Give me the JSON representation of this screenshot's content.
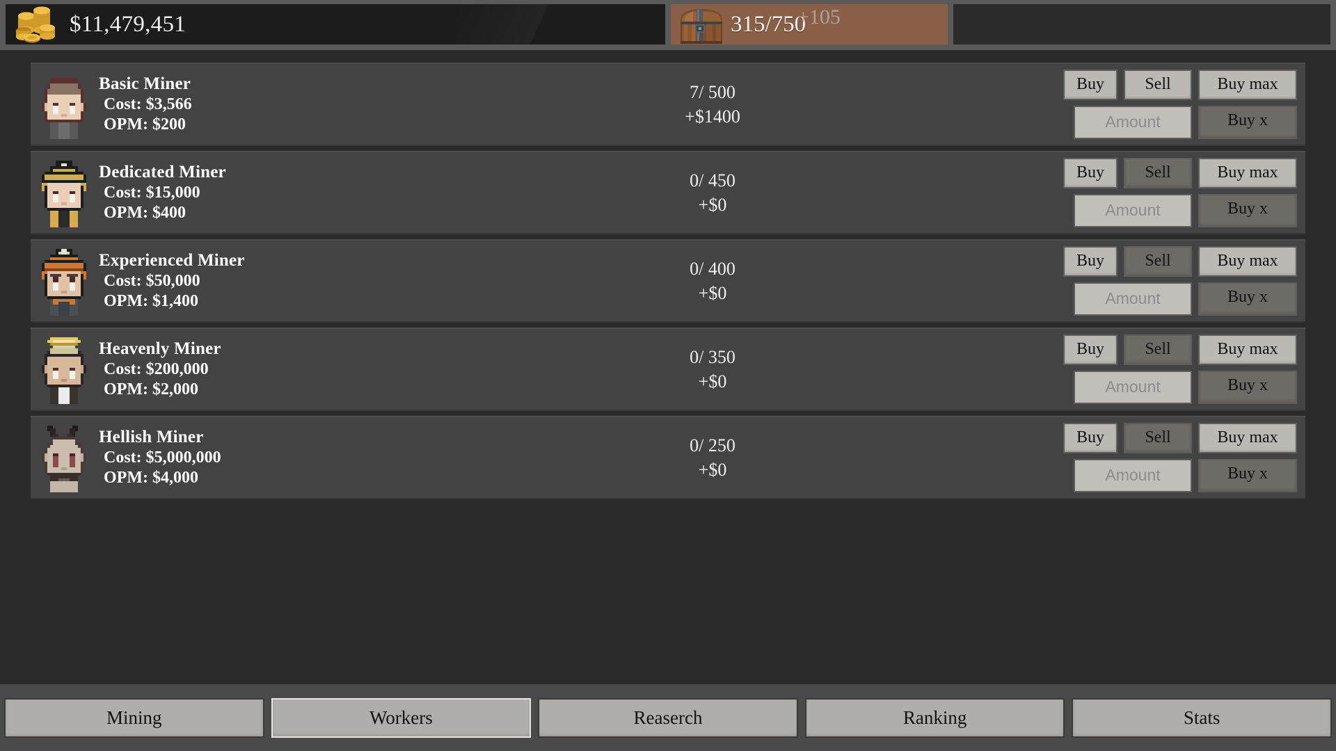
{
  "topbar": {
    "money_icon": "gold-coins-icon",
    "money_value": "$11,479,451",
    "chest_icon": "treasure-chest-icon",
    "chest_value": "315/750",
    "chest_gain": "+105"
  },
  "workers": [
    {
      "avatar": "bald-miner-avatar",
      "name": "Basic Miner",
      "cost": "Cost: $3,566",
      "opm": "OPM: $200",
      "count": "7/ 500",
      "income": "+$1400",
      "buy_label": "Buy",
      "sell_label": "Sell",
      "buymax_label": "Buy max",
      "amount_placeholder": "Amount",
      "amount_value": "",
      "buyx_label": "Buy x",
      "sell_enabled": true
    },
    {
      "avatar": "gold-helmet-miner-avatar",
      "name": "Dedicated Miner",
      "cost": "Cost: $15,000",
      "opm": "OPM: $400",
      "count": "0/ 450",
      "income": "+$0",
      "buy_label": "Buy",
      "sell_label": "Sell",
      "buymax_label": "Buy max",
      "amount_placeholder": "Amount",
      "amount_value": "",
      "buyx_label": "Buy x",
      "sell_enabled": false
    },
    {
      "avatar": "orange-helmet-miner-avatar",
      "name": "Experienced Miner",
      "cost": "Cost: $50,000",
      "opm": "OPM: $1,400",
      "count": "0/ 400",
      "income": "+$0",
      "buy_label": "Buy",
      "sell_label": "Sell",
      "buymax_label": "Buy max",
      "amount_placeholder": "Amount",
      "amount_value": "",
      "buyx_label": "Buy x",
      "sell_enabled": false
    },
    {
      "avatar": "halo-miner-avatar",
      "name": "Heavenly Miner",
      "cost": "Cost: $200,000",
      "opm": "OPM: $2,000",
      "count": "0/ 350",
      "income": "+$0",
      "buy_label": "Buy",
      "sell_label": "Sell",
      "buymax_label": "Buy max",
      "amount_placeholder": "Amount",
      "amount_value": "",
      "buyx_label": "Buy x",
      "sell_enabled": false
    },
    {
      "avatar": "horned-miner-avatar",
      "name": "Hellish Miner",
      "cost": "Cost: $5,000,000",
      "opm": "OPM: $4,000",
      "count": "0/ 250",
      "income": "+$0",
      "buy_label": "Buy",
      "sell_label": "Sell",
      "buymax_label": "Buy max",
      "amount_placeholder": "Amount",
      "amount_value": "",
      "buyx_label": "Buy x",
      "sell_enabled": false
    }
  ],
  "nav": {
    "tabs": [
      {
        "label": "Mining",
        "active": false
      },
      {
        "label": "Workers",
        "active": true
      },
      {
        "label": "Reaserch",
        "active": false
      },
      {
        "label": "Ranking",
        "active": false
      },
      {
        "label": "Stats",
        "active": false
      }
    ]
  },
  "colors": {
    "panel_dark": "#1c1c1c",
    "chest_brown": "#8a5f47",
    "row_bg": "#434343",
    "content_bg": "#2a2a2a",
    "button_light": "#bcb9b4",
    "button_dark": "#6e6a66",
    "nav_bg": "#4a4a4a"
  }
}
